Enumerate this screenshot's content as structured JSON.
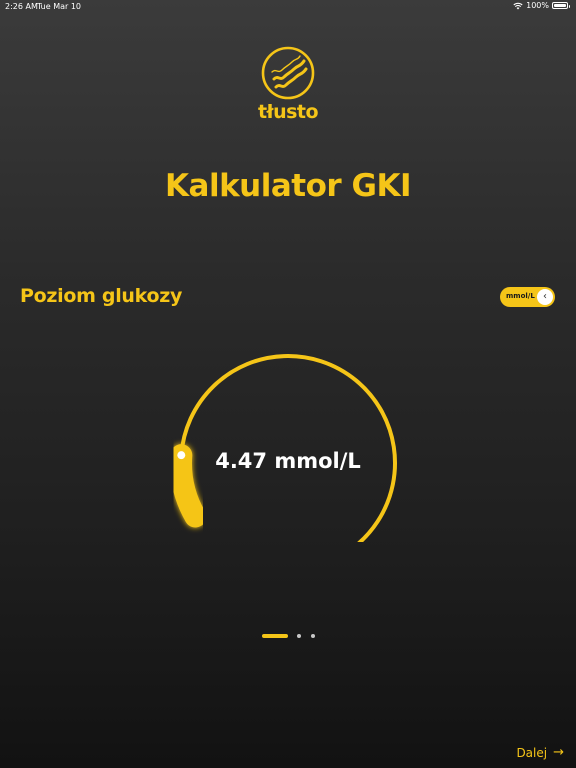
{
  "status_bar": {
    "time": "2:26 AM",
    "date": "Tue Mar 10",
    "battery": "100%"
  },
  "logo": {
    "text": "tłusto",
    "icon": "bacon-logo-icon"
  },
  "page": {
    "title": "Kalkulator GKI"
  },
  "glucose": {
    "section_title": "Poziom glukozy",
    "unit_toggle_label": "mmol/L",
    "value_display": "4.47 mmol/L",
    "fill_fraction": 0.12
  },
  "pager": {
    "active_index": 0,
    "count": 3
  },
  "footer": {
    "next_label": "Dalej",
    "next_icon": "arrow-right-icon"
  },
  "colors": {
    "accent": "#f5c518",
    "background_top": "#3b3b3b",
    "background_bottom": "#121212"
  }
}
